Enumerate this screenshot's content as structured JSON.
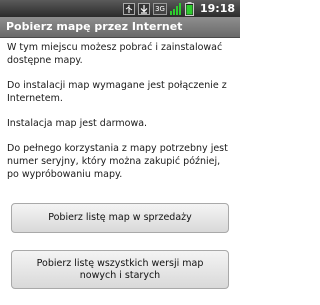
{
  "status_bar": {
    "network_label": "3G",
    "time": "19:18"
  },
  "title_bar": {
    "title": "Pobierz mapę przez Internet"
  },
  "content": {
    "paragraphs": [
      "W tym miejscu możesz pobrać i zainstalować dostępne mapy.",
      "Do instalacji map wymagane jest połączenie z Internetem.",
      "Instalacja map jest darmowa.",
      "Do pełnego korzystania z mapy potrzebny jest numer seryjny, który można zakupić później, po wypróbowaniu mapy."
    ]
  },
  "buttons": {
    "sale_maps": "Pobierz listę map w sprzedaży",
    "all_versions": "Pobierz listę wszystkich wersji map nowych i starych"
  },
  "colors": {
    "status_bar": "#2b2b2b",
    "title_bar": "#7c7c7c",
    "background": "#ffffff",
    "signal_green": "#2ecc2e"
  }
}
